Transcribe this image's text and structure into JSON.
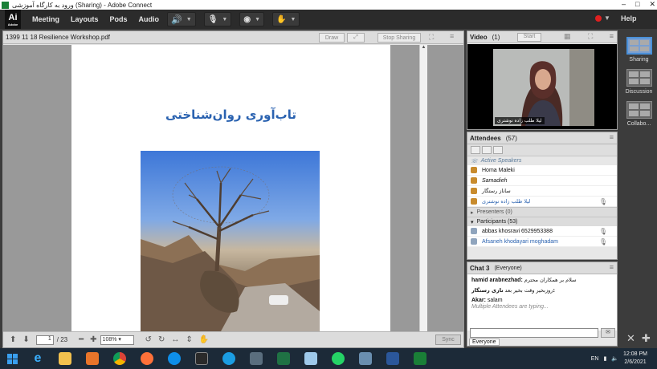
{
  "window": {
    "title": "ورود به کارگاه آموزشی (Sharing) - Adobe Connect"
  },
  "menu": {
    "logo": "Ai",
    "logo_sub": "Adobe",
    "items": [
      "Meeting",
      "Layouts",
      "Pods",
      "Audio"
    ],
    "help": "Help"
  },
  "share_pod": {
    "title": "1399 11 18 Resilience Workshop.pdf",
    "draw_btn": "Draw",
    "stop_btn": "Stop Sharing",
    "page_title": "تاب‌آوری روان‌شناختی",
    "page_current": "1",
    "page_total": "/ 23",
    "zoom": "108%",
    "sync": "Sync"
  },
  "video_pod": {
    "title": "Video",
    "count": "(1)",
    "start_btn": "Start",
    "name_label": "لیلا طلب زاده نوشتری"
  },
  "attendees_pod": {
    "title": "Attendees",
    "count": "(57)",
    "active_speakers": "Active Speakers",
    "hosts": [
      "Homa Maleki",
      "Samadieh",
      "ساناز رستگار",
      "لیلا طلب زاده نوشتری"
    ],
    "presenters": "Presenters (0)",
    "participants": "Participants (53)",
    "participant_list": [
      "abbas khosravi 6529953388",
      "Afsaneh khodayari moghadam"
    ]
  },
  "chat_pod": {
    "title": "Chat",
    "count": "3",
    "scope": "(Everyone)",
    "messages": [
      {
        "sender": "hamid arabnezhad:",
        "text": "سلام بر همکاران محترم"
      },
      {
        "sender": "نازی رستگار:",
        "text": "روزبخیر وقت بخیر بعد"
      },
      {
        "sender": "Akar:",
        "text": "salam"
      }
    ],
    "typing": "Multiple Attendees are typing...",
    "tab": "Everyone"
  },
  "layouts": [
    "Sharing",
    "Discussion",
    "Collabo..."
  ],
  "taskbar": {
    "lang": "EN",
    "time": "12:08 PM",
    "date": "2/6/2021"
  }
}
